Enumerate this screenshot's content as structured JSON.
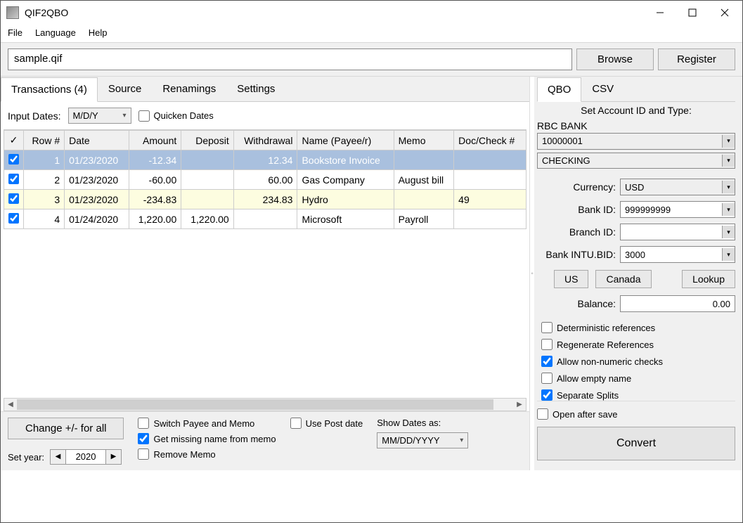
{
  "window": {
    "title": "QIF2QBO"
  },
  "menu": {
    "file": "File",
    "language": "Language",
    "help": "Help"
  },
  "toolbar": {
    "filepath": "sample.qif",
    "browse": "Browse",
    "register": "Register"
  },
  "left_tabs": {
    "transactions": "Transactions (4)",
    "source": "Source",
    "renamings": "Renamings",
    "settings": "Settings"
  },
  "options": {
    "input_dates_label": "Input Dates:",
    "input_dates_value": "M/D/Y",
    "quicken_dates_label": "Quicken Dates"
  },
  "grid": {
    "headers": {
      "check": "✓",
      "row": "Row #",
      "date": "Date",
      "amount": "Amount",
      "deposit": "Deposit",
      "withdrawal": "Withdrawal",
      "name": "Name (Payee/r)",
      "memo": "Memo",
      "doc": "Doc/Check #"
    },
    "rows": [
      {
        "row": "1",
        "date": "01/23/2020",
        "amount": "-12.34",
        "deposit": "",
        "withdrawal": "12.34",
        "name": "Bookstore Invoice",
        "memo": "",
        "doc": ""
      },
      {
        "row": "2",
        "date": "01/23/2020",
        "amount": "-60.00",
        "deposit": "",
        "withdrawal": "60.00",
        "name": "Gas Company",
        "memo": "August bill",
        "doc": ""
      },
      {
        "row": "3",
        "date": "01/23/2020",
        "amount": "-234.83",
        "deposit": "",
        "withdrawal": "234.83",
        "name": "Hydro",
        "memo": "",
        "doc": "49"
      },
      {
        "row": "4",
        "date": "01/24/2020",
        "amount": "1,220.00",
        "deposit": "1,220.00",
        "withdrawal": "",
        "name": "Microsoft",
        "memo": "Payroll",
        "doc": ""
      }
    ]
  },
  "bottom": {
    "change_btn": "Change +/- for all",
    "set_year_label": "Set year:",
    "set_year_value": "2020",
    "switch_payee": "Switch Payee and Memo",
    "get_missing": "Get missing name from memo",
    "remove_memo": "Remove Memo",
    "use_post_date": "Use Post date",
    "show_dates_label": "Show Dates as:",
    "show_dates_value": "MM/DD/YYYY"
  },
  "right": {
    "tabs": {
      "qbo": "QBO",
      "csv": "CSV"
    },
    "section_title": "Set Account ID and Type:",
    "bank_name": "RBC BANK",
    "account_id": "10000001",
    "account_type": "CHECKING",
    "currency_label": "Currency:",
    "currency_value": "USD",
    "bankid_label": "Bank ID:",
    "bankid_value": "999999999",
    "branch_label": "Branch ID:",
    "branch_value": "",
    "intubid_label": "Bank INTU.BID:",
    "intubid_value": "3000",
    "btn_us": "US",
    "btn_canada": "Canada",
    "btn_lookup": "Lookup",
    "balance_label": "Balance:",
    "balance_value": "0.00",
    "chk_det": "Deterministic references",
    "chk_regen": "Regenerate References",
    "chk_allow_nonnum": "Allow non-numeric checks",
    "chk_allow_empty": "Allow empty name",
    "chk_sep_splits": "Separate Splits",
    "chk_open_after": "Open after save",
    "convert": "Convert"
  }
}
